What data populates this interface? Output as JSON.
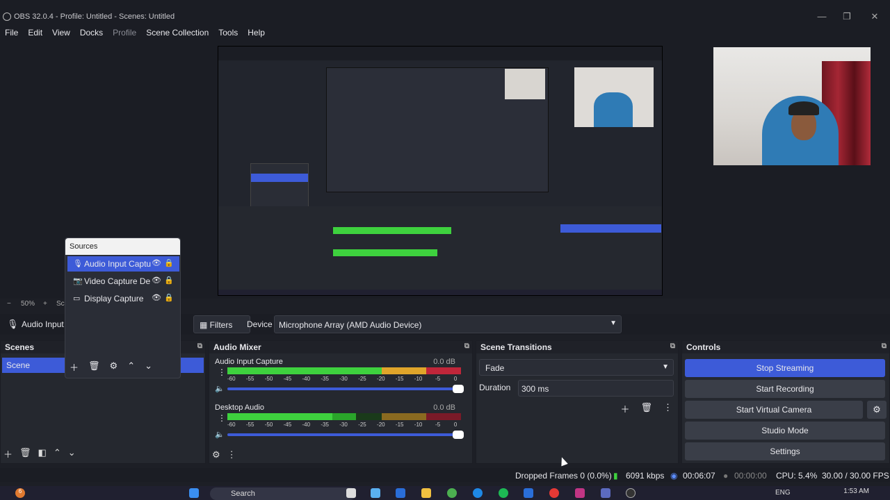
{
  "window": {
    "title": "OBS 32.0.4 - Profile: Untitled - Scenes: Untitled"
  },
  "menu": [
    "File",
    "Edit",
    "View",
    "Docks",
    "Profile",
    "Scene Collection",
    "Tools",
    "Help"
  ],
  "zoom": {
    "minus": "−",
    "value": "50%",
    "plus": "+",
    "cut": "Sc"
  },
  "source_bar": {
    "source_label": "Audio Input",
    "filters_label": "Filters",
    "device_label": "Device",
    "device_value": "Microphone Array (AMD Audio Device)"
  },
  "scenes": {
    "title": "Scenes",
    "items": [
      "Scene"
    ]
  },
  "sources_popup": {
    "title": "Sources",
    "items": [
      "Audio Input Captu",
      "Video Capture De",
      "Display Capture"
    ]
  },
  "mixer": {
    "title": "Audio Mixer",
    "ticks": [
      "-60",
      "-55",
      "-50",
      "-45",
      "-40",
      "-35",
      "-30",
      "-25",
      "-20",
      "-15",
      "-10",
      "-5",
      "0"
    ],
    "channels": [
      {
        "name": "Audio Input Capture",
        "db": "0.0 dB",
        "level": 0.85
      },
      {
        "name": "Desktop Audio",
        "db": "0.0 dB",
        "level": 0.6
      }
    ]
  },
  "transitions": {
    "title": "Scene Transitions",
    "selected": "Fade",
    "duration_label": "Duration",
    "duration_value": "300 ms"
  },
  "controls": {
    "title": "Controls",
    "buttons": [
      "Stop Streaming",
      "Start Recording",
      "Start Virtual Camera",
      "Studio Mode",
      "Settings"
    ]
  },
  "status": {
    "dropped": "Dropped Frames 0 (0.0%)",
    "bitrate": "6091 kbps",
    "stream_time": "00:06:07",
    "rec_time": "00:00:00",
    "cpu": "CPU: 5.4%",
    "fps": "30.00 / 30.00 FPS"
  },
  "taskbar": {
    "search": "Search",
    "lang": "ENG",
    "time": "1:53 AM",
    "badge": "6"
  }
}
